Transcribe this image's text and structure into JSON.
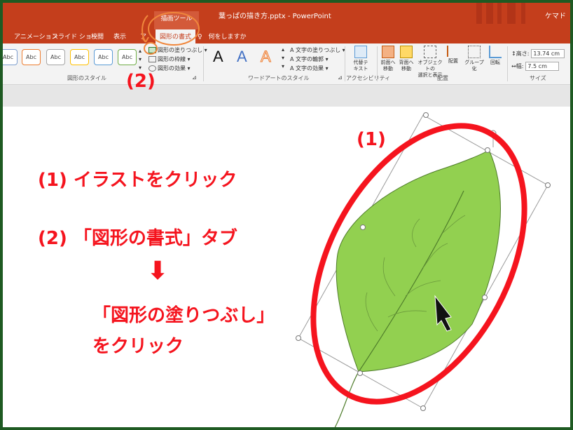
{
  "titlebar": {
    "context_tab": "描画ツール",
    "document_title": "葉っぱの描き方.pptx  -  PowerPoint",
    "user": "ケマド"
  },
  "tabs": [
    {
      "label": "アニメーション"
    },
    {
      "label": "スライド ショー"
    },
    {
      "label": "校閲"
    },
    {
      "label": "表示"
    },
    {
      "label": "ア"
    },
    {
      "label": "図形の書式",
      "active": true
    }
  ],
  "tell_me": "何をしますか",
  "ribbon": {
    "shape_styles": {
      "swatches": [
        "Abc",
        "Abc",
        "Abc",
        "Abc",
        "Abc",
        "Abc"
      ],
      "swatch_colors": [
        "#7f9fcf",
        "#ed7d31",
        "#a5a5a5",
        "#ffc000",
        "#5b9bd5",
        "#70ad47"
      ],
      "fill_label": "図形の塗りつぶし",
      "outline_label": "図形の枠線",
      "effects_label": "図形の効果",
      "group_label": "図形のスタイル"
    },
    "wordart": {
      "samples": [
        "A",
        "A",
        "A"
      ],
      "text_fill": "文字の塗りつぶし",
      "text_outline": "文字の輪郭",
      "text_effects": "文字の効果",
      "group_label": "ワードアートのスタイル"
    },
    "accessibility": {
      "alt_text_line1": "代替テ",
      "alt_text_line2": "キスト",
      "group_label": "アクセシビリティ"
    },
    "arrange": {
      "bring_forward": [
        "前面へ",
        "移動"
      ],
      "send_backward": [
        "背面へ",
        "移動"
      ],
      "selection_pane": [
        "オブジェクトの",
        "選択と表示"
      ],
      "align": [
        "配置"
      ],
      "group": [
        "グループ化"
      ],
      "rotate": [
        "回転"
      ],
      "group_label": "配置"
    },
    "size": {
      "height_label": "高さ:",
      "height_value": "13.74 cm",
      "width_label": "幅:",
      "width_value": "7.5 cm",
      "group_label": "サイズ"
    }
  },
  "slide": {
    "step1": "(1) イラストをクリック",
    "step2": "(2) 「図形の書式」タブ",
    "arrow": "⬇",
    "step3a": "「図形の塗りつぶし」",
    "step3b": "をクリック",
    "marker1": "(1)",
    "marker2": "(2)"
  },
  "colors": {
    "ribbon_red": "#c43e1c",
    "annotation_red": "#f5141e",
    "highlight_orange": "#f0873c",
    "leaf_green": "#92d050",
    "frame_green": "#1e5a22"
  }
}
